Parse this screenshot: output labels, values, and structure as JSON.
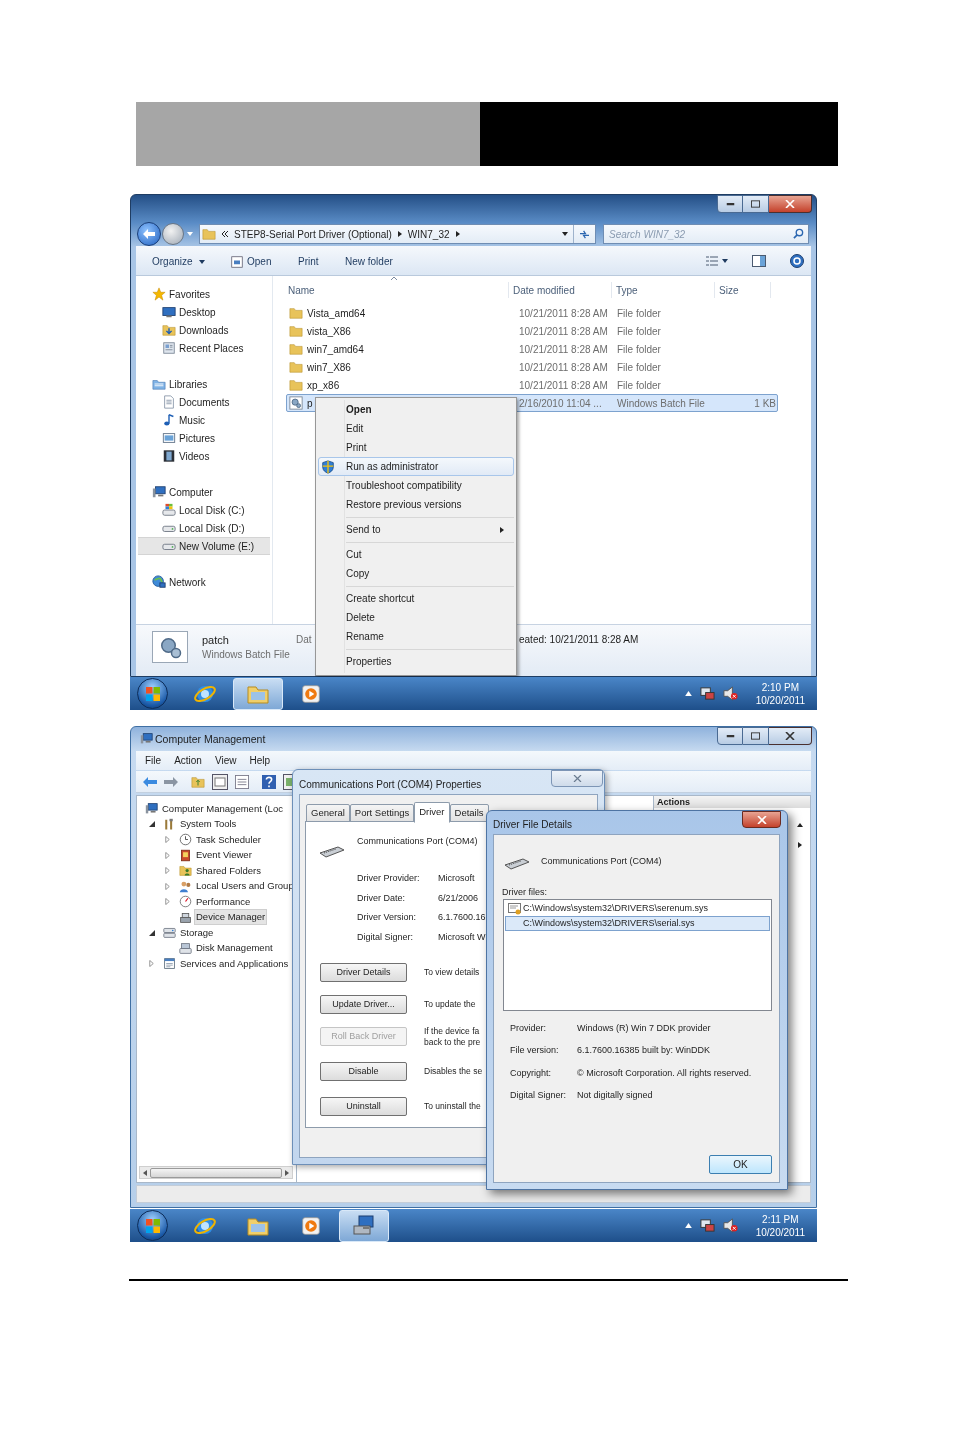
{
  "explorer": {
    "address": [
      "STEP8-Serial Port Driver (Optional)",
      "WIN7_32"
    ],
    "search_placeholder": "Search WIN7_32",
    "toolbar": [
      "Organize",
      "Open",
      "Print",
      "New folder"
    ],
    "nav": [
      {
        "label": "Favorites",
        "kind": "star",
        "selected": false,
        "children": [
          {
            "label": "Desktop",
            "kind": "desktop",
            "selected": false
          },
          {
            "label": "Downloads",
            "kind": "download",
            "selected": false
          },
          {
            "label": "Recent Places",
            "kind": "recent",
            "selected": false
          }
        ]
      },
      {
        "label": "Libraries",
        "kind": "library",
        "selected": false,
        "children": [
          {
            "label": "Documents",
            "kind": "document",
            "selected": false
          },
          {
            "label": "Music",
            "kind": "music",
            "selected": false
          },
          {
            "label": "Pictures",
            "kind": "picture",
            "selected": false
          },
          {
            "label": "Videos",
            "kind": "video",
            "selected": false
          }
        ]
      },
      {
        "label": "Computer",
        "kind": "computer",
        "selected": false,
        "children": [
          {
            "label": "Local Disk (C:)",
            "kind": "sysdisk",
            "selected": false
          },
          {
            "label": "Local Disk (D:)",
            "kind": "disk",
            "selected": false
          },
          {
            "label": "New Volume (E:)",
            "kind": "disk",
            "selected": true
          }
        ]
      },
      {
        "label": "Network",
        "kind": "network",
        "selected": false
      }
    ],
    "columns": [
      "Name",
      "Date modified",
      "Type",
      "Size"
    ],
    "rows": [
      {
        "name": "Vista_amd64",
        "date": "10/21/2011 8:28 AM",
        "type": "File folder",
        "kind": "folder",
        "selected": false
      },
      {
        "name": "vista_X86",
        "date": "10/21/2011 8:28 AM",
        "type": "File folder",
        "kind": "folder",
        "selected": false
      },
      {
        "name": "win7_amd64",
        "date": "10/21/2011 8:28 AM",
        "type": "File folder",
        "kind": "folder",
        "selected": false
      },
      {
        "name": "win7_X86",
        "date": "10/21/2011 8:28 AM",
        "type": "File folder",
        "kind": "folder",
        "selected": false
      },
      {
        "name": "xp_x86",
        "date": "10/21/2011 8:28 AM",
        "type": "File folder",
        "kind": "folder",
        "selected": false
      },
      {
        "name": "p",
        "date": "2/16/2010 11:04 ...",
        "type": "Windows Batch File",
        "size": "1 KB",
        "kind": "batch",
        "selected": true
      }
    ],
    "context_menu": {
      "groups": [
        {
          "items": [
            {
              "label": "Open",
              "kind": "default",
              "selected": false
            },
            {
              "label": "Edit",
              "kind": "plain",
              "selected": false
            },
            {
              "label": "Print",
              "kind": "plain",
              "selected": false
            },
            {
              "label": "Run as administrator",
              "kind": "elevated",
              "selected": true
            },
            {
              "label": "Troubleshoot compatibility",
              "kind": "plain",
              "selected": false
            },
            {
              "label": "Restore previous versions",
              "kind": "plain",
              "selected": false
            }
          ]
        },
        {
          "items": [
            {
              "label": "Send to",
              "kind": "submenu",
              "selected": false
            }
          ]
        },
        {
          "items": [
            {
              "label": "Cut",
              "kind": "plain",
              "selected": false
            },
            {
              "label": "Copy",
              "kind": "plain",
              "selected": false
            }
          ]
        },
        {
          "items": [
            {
              "label": "Create shortcut",
              "kind": "plain",
              "selected": false
            },
            {
              "label": "Delete",
              "kind": "plain",
              "selected": false
            },
            {
              "label": "Rename",
              "kind": "plain",
              "selected": false
            }
          ]
        },
        {
          "items": [
            {
              "label": "Properties",
              "kind": "plain",
              "selected": false
            }
          ]
        }
      ]
    },
    "details": {
      "name": "patch",
      "type": "Windows Batch File",
      "property_label": "Dat",
      "created": "eated: 10/21/2011 8:28 AM"
    },
    "taskbar": {
      "apps": [
        {
          "kind": "browser",
          "selected": false
        },
        {
          "kind": "folders",
          "selected": true
        },
        {
          "kind": "player",
          "selected": false
        }
      ],
      "time": "2:10 PM",
      "date": "10/20/2011"
    }
  },
  "management": {
    "title": "Computer Management",
    "menu": [
      "File",
      "Action",
      "View",
      "Help"
    ],
    "tree": [
      {
        "label": "Computer Management (Loc",
        "kind": "computer",
        "selected": false,
        "children": [
          {
            "label": "System Tools",
            "kind": "tools",
            "expanded": true,
            "selected": false,
            "children": [
              {
                "label": "Task Scheduler",
                "kind": "clock",
                "expanded": false,
                "selected": false
              },
              {
                "label": "Event Viewer",
                "kind": "log",
                "expanded": false,
                "selected": false
              },
              {
                "label": "Shared Folders",
                "kind": "share",
                "expanded": false,
                "selected": false
              },
              {
                "label": "Local Users and Group",
                "kind": "users",
                "expanded": false,
                "selected": false
              },
              {
                "label": "Performance",
                "kind": "gauge",
                "expanded": false,
                "selected": false
              },
              {
                "label": "Device Manager",
                "kind": "device",
                "selected": true
              }
            ]
          },
          {
            "label": "Storage",
            "kind": "storage",
            "expanded": true,
            "selected": false,
            "children": [
              {
                "label": "Disk Management",
                "kind": "diskmgmt",
                "selected": false
              }
            ]
          },
          {
            "label": "Services and Applications",
            "kind": "services",
            "expanded": false,
            "selected": false
          }
        ]
      }
    ],
    "actions_heading": "Actions",
    "properties": {
      "title": "Communications Port (COM4) Properties",
      "tabs": [
        {
          "label": "General",
          "selected": false
        },
        {
          "label": "Port Settings",
          "selected": false
        },
        {
          "label": "Driver",
          "selected": true
        },
        {
          "label": "Details",
          "selected": false
        }
      ],
      "device": "Communications Port (COM4)",
      "fields": [
        {
          "label": "Driver Provider:",
          "value": "Microsoft"
        },
        {
          "label": "Driver Date:",
          "value": "6/21/2006"
        },
        {
          "label": "Driver Version:",
          "value": "6.1.7600.16"
        },
        {
          "label": "Digital Signer:",
          "value": "Microsoft W"
        }
      ],
      "buttons": [
        {
          "label": "Driver Details",
          "disabled": false,
          "description": "To view details"
        },
        {
          "label": "Update Driver...",
          "disabled": false,
          "description": "To update the"
        },
        {
          "label": "Roll Back Driver",
          "disabled": true,
          "description": "If the device fa\nback to the pre"
        },
        {
          "label": "Disable",
          "disabled": false,
          "description": "Disables the se"
        },
        {
          "label": "Uninstall",
          "disabled": false,
          "description": "To uninstall the"
        }
      ]
    },
    "driver_details": {
      "title": "Driver File Details",
      "device": "Communications Port (COM4)",
      "files_label": "Driver files:",
      "files": [
        {
          "path": "C:\\Windows\\system32\\DRIVERS\\serenum.sys",
          "kind": "certified",
          "selected": false
        },
        {
          "path": "C:\\Windows\\system32\\DRIVERS\\serial.sys",
          "kind": "plain",
          "selected": true
        }
      ],
      "fields": [
        {
          "label": "Provider:",
          "value": "Windows (R) Win 7 DDK provider"
        },
        {
          "label": "File version:",
          "value": "6.1.7600.16385 built by: WinDDK"
        },
        {
          "label": "Copyright:",
          "value": "© Microsoft Corporation. All rights reserved."
        },
        {
          "label": "Digital Signer:",
          "value": "Not digitally signed"
        }
      ],
      "ok": "OK"
    },
    "taskbar": {
      "apps": [
        {
          "kind": "browser",
          "selected": false
        },
        {
          "kind": "folders",
          "selected": false
        },
        {
          "kind": "player",
          "selected": false
        },
        {
          "kind": "computer",
          "selected": true
        }
      ],
      "time": "2:11 PM",
      "date": "10/20/2011"
    }
  }
}
